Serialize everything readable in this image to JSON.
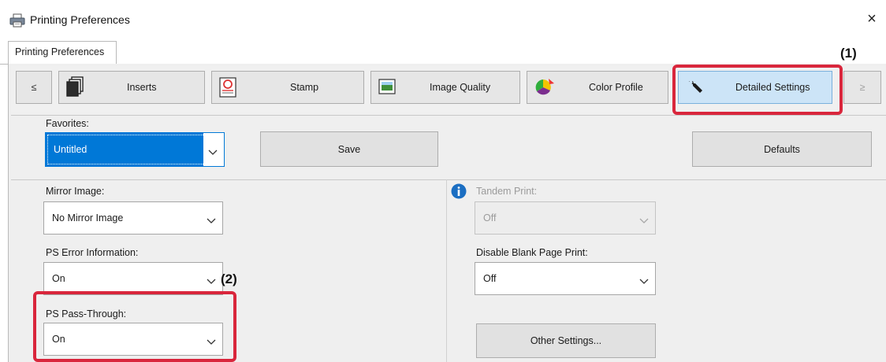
{
  "window": {
    "title": "Printing Preferences",
    "close_glyph": "×"
  },
  "tabs": [
    {
      "label": "Printing Preferences"
    }
  ],
  "toolbar": {
    "prev_label": "≤",
    "next_label": "≥",
    "buttons": [
      {
        "label": "Inserts",
        "icon": "inserts-icon"
      },
      {
        "label": "Stamp",
        "icon": "stamp-icon"
      },
      {
        "label": "Image Quality",
        "icon": "image-quality-icon"
      },
      {
        "label": "Color Profile",
        "icon": "color-profile-icon"
      },
      {
        "label": "Detailed Settings",
        "icon": "wrench-icon",
        "active": true
      }
    ]
  },
  "favorites": {
    "label": "Favorites:",
    "value": "Untitled",
    "save_label": "Save",
    "defaults_label": "Defaults"
  },
  "left_column": {
    "mirror_image": {
      "label": "Mirror Image:",
      "value": "No Mirror Image"
    },
    "ps_error_info": {
      "label": "PS Error Information:",
      "value": "On"
    },
    "ps_pass_through": {
      "label": "PS Pass-Through:",
      "value": "On"
    }
  },
  "right_column": {
    "tandem_print": {
      "label": "Tandem Print:",
      "value": "Off",
      "enabled": false
    },
    "disable_blank_page": {
      "label": "Disable Blank Page Print:",
      "value": "Off"
    },
    "other_settings_label": "Other Settings..."
  },
  "callouts": {
    "one": "(1)",
    "two": "(2)",
    "color": "#d9263c"
  },
  "colors": {
    "selection_blue": "#0078d7",
    "active_tab_bg": "#cce4f7",
    "info_blue": "#1b6ec2"
  }
}
